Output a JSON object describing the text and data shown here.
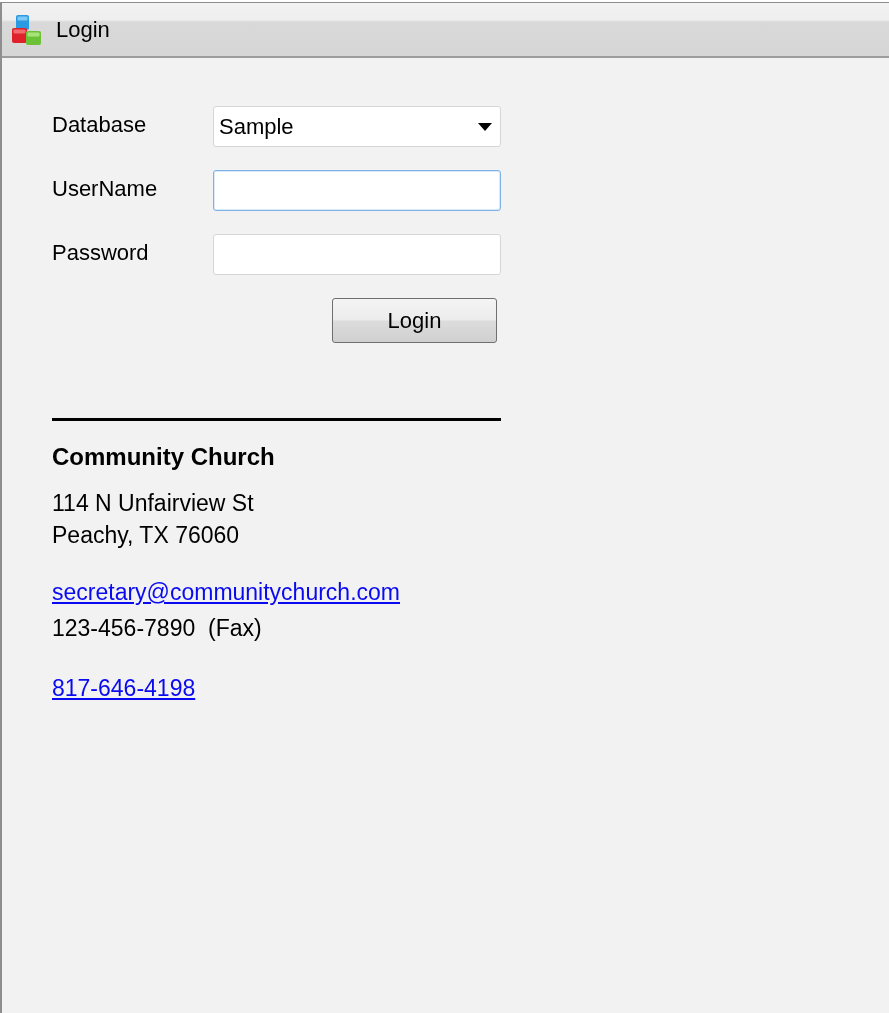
{
  "window": {
    "title": "Login"
  },
  "form": {
    "fields": [
      {
        "kind": "select",
        "label": "Database",
        "value": "Sample",
        "focused": false
      },
      {
        "kind": "text",
        "label": "UserName",
        "focused": true
      },
      {
        "kind": "password",
        "label": "Password",
        "focused": false
      }
    ],
    "submit": "Login"
  },
  "contact": {
    "name": "Community Church",
    "address": [
      "114 N Unfairview St",
      "Peachy, TX 76060"
    ],
    "email": "secretary@communitychurch.com",
    "fax": "123-456-7890  (Fax)",
    "phone": "817-646-4198"
  }
}
